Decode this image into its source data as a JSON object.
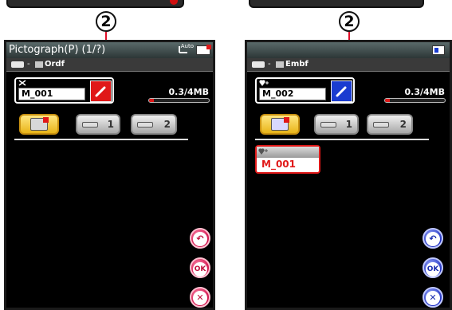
{
  "callouts": {
    "left": "2",
    "right": "2"
  },
  "left_screen": {
    "title": "Pictograph(P) (1/?)",
    "status_text": "Auto",
    "path_folder": "Ordf",
    "name_value": "M_001",
    "memory": "0.3/4MB",
    "memory_fraction": 0.08,
    "tabs": [
      "",
      "1",
      "2"
    ],
    "buttons": {
      "back": "back",
      "ok": "OK",
      "cancel": "cancel"
    }
  },
  "right_screen": {
    "title": "",
    "path_folder": "Embf",
    "name_value": "M_002",
    "memory": "0.3/4MB",
    "memory_fraction": 0.08,
    "tabs": [
      "",
      "1",
      "2"
    ],
    "file_item": "M_001",
    "buttons": {
      "back": "back",
      "ok": "OK",
      "cancel": "cancel"
    }
  },
  "colors": {
    "accent_red": "#e01818",
    "accent_blue": "#1a3cd0",
    "tab_active": "#f0c030"
  }
}
